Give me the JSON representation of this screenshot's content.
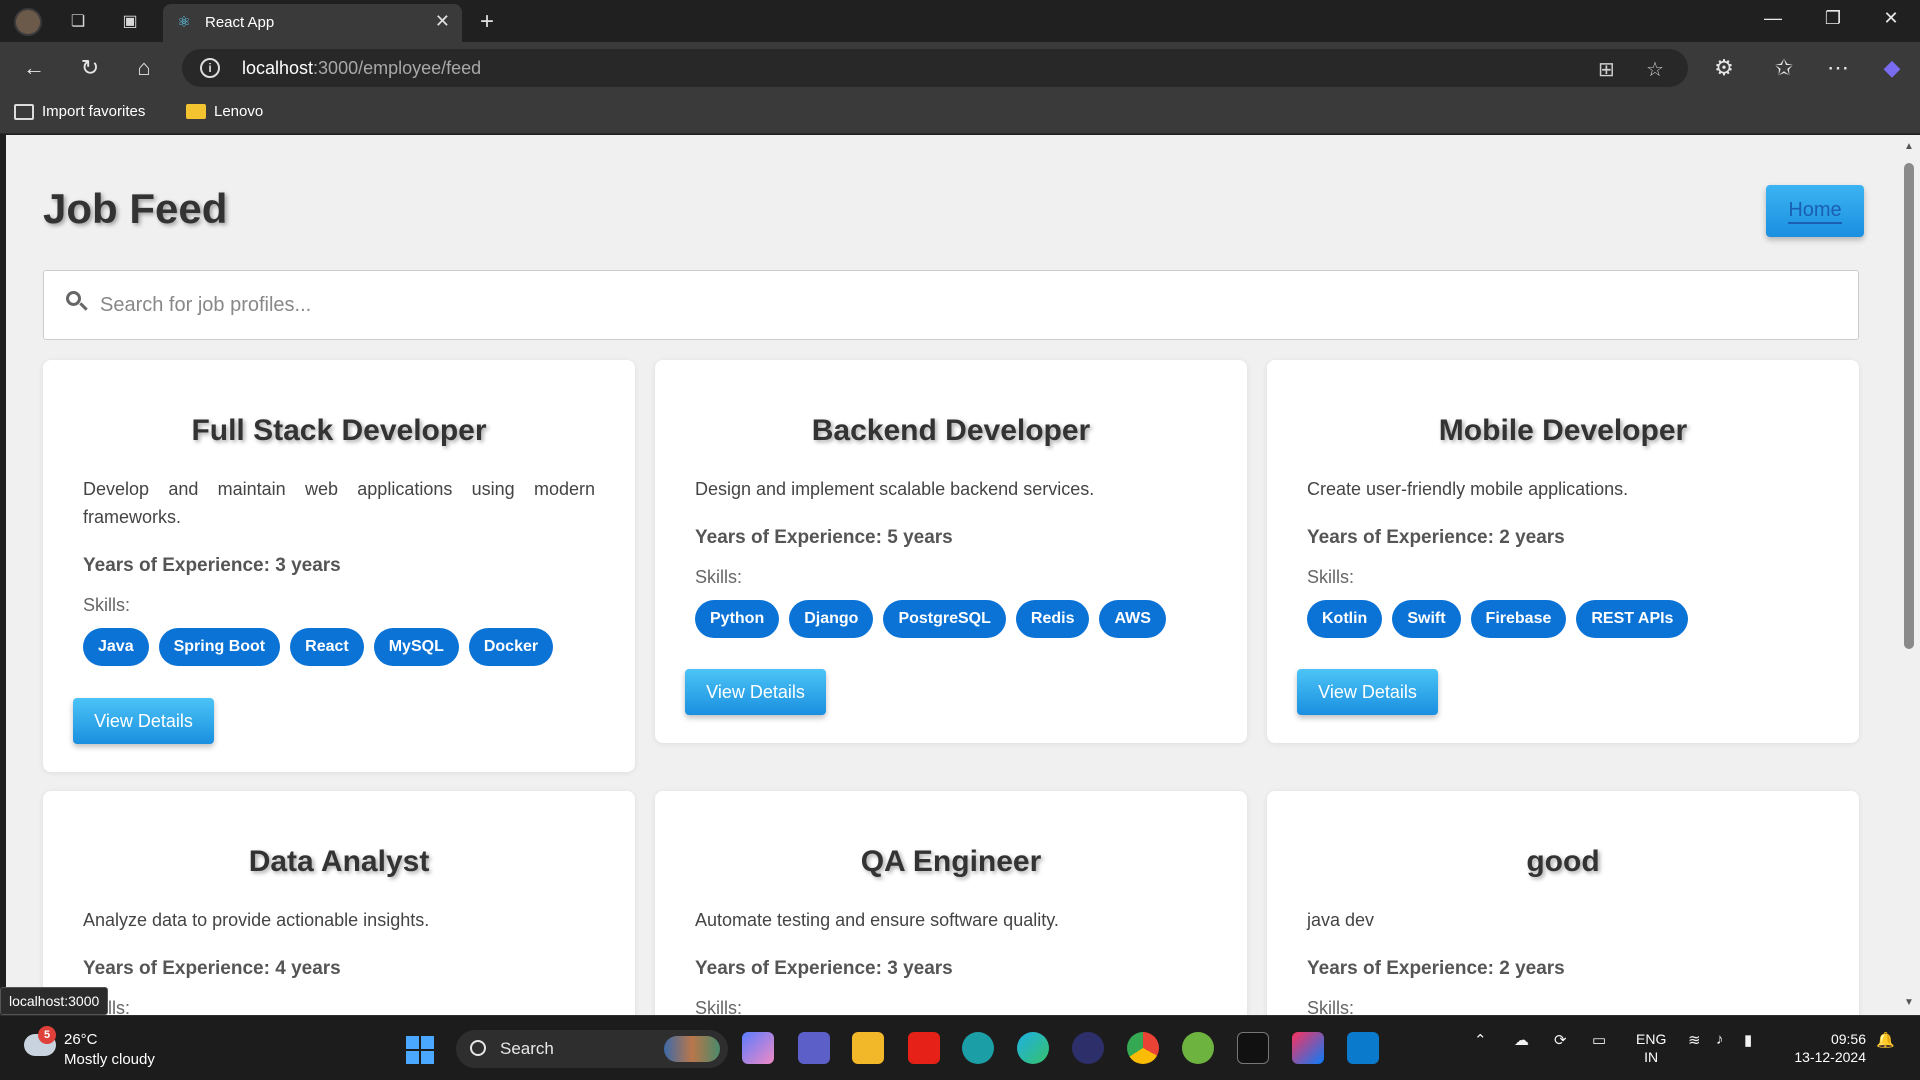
{
  "browser": {
    "tab_title": "React App",
    "url_host": "localhost",
    "url_path": ":3000/employee/feed",
    "bookmarks": [
      {
        "label": "Import favorites"
      },
      {
        "label": "Lenovo"
      }
    ],
    "status_url": "localhost:3000"
  },
  "page": {
    "title": "Job Feed",
    "home_label": "Home",
    "search_placeholder": "Search for job profiles...",
    "exp_prefix": "Years of Experience:",
    "skills_label": "Skills:",
    "view_details_label": "View Details",
    "jobs": [
      {
        "title": "Full Stack Developer",
        "description": "Develop and maintain web applications using modern frameworks.",
        "experience": "3 years",
        "skills": [
          "Java",
          "Spring Boot",
          "React",
          "MySQL",
          "Docker"
        ]
      },
      {
        "title": "Backend Developer",
        "description": "Design and implement scalable backend services.",
        "experience": "5 years",
        "skills": [
          "Python",
          "Django",
          "PostgreSQL",
          "Redis",
          "AWS"
        ]
      },
      {
        "title": "Mobile Developer",
        "description": "Create user-friendly mobile applications.",
        "experience": "2 years",
        "skills": [
          "Kotlin",
          "Swift",
          "Firebase",
          "REST APIs"
        ]
      },
      {
        "title": "Data Analyst",
        "description": "Analyze data to provide actionable insights.",
        "experience": "4 years",
        "skills": []
      },
      {
        "title": "QA Engineer",
        "description": "Automate testing and ensure software quality.",
        "experience": "3 years",
        "skills": []
      },
      {
        "title": "good",
        "description": "java dev",
        "experience": "2 years",
        "skills": []
      }
    ]
  },
  "taskbar": {
    "weather_badge": "5",
    "weather_temp": "26°C",
    "weather_desc": "Mostly cloudy",
    "search_label": "Search",
    "lang_line1": "ENG",
    "lang_line2": "IN",
    "time": "09:56",
    "date": "13-12-2024"
  },
  "colors": {
    "accent": "#0b73d6",
    "button_gradient_top": "#4cc4f6",
    "button_gradient_bottom": "#1a8fe0"
  }
}
